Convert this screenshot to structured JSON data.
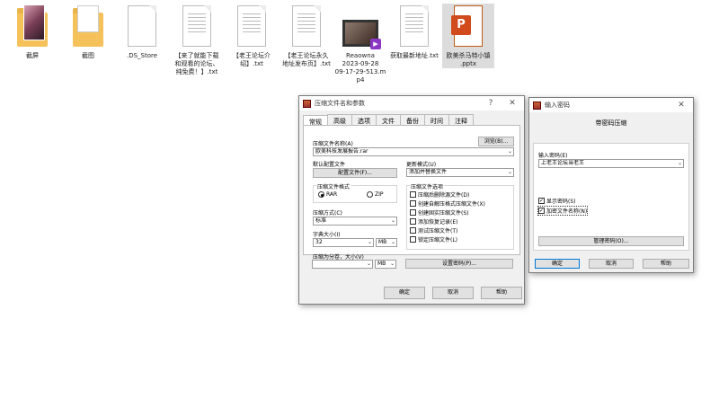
{
  "desktop": {
    "files": [
      {
        "label": "截屏",
        "type": "folder-photo"
      },
      {
        "label": "截图",
        "type": "folder-doc"
      },
      {
        "label": ".DS_Store",
        "type": "doc"
      },
      {
        "label": "【来了就能下载\n和观看的论坛、\n纯免费！】.txt",
        "type": "doc"
      },
      {
        "label": "【老王论坛介\n绍】.txt",
        "type": "doc"
      },
      {
        "label": "【老王论坛永久\n地址发布页】.txt",
        "type": "doc"
      },
      {
        "label": "Reaowna\n2023-09-28\n09-17-29-513.m\np4",
        "type": "video"
      },
      {
        "label": "获取最新地址.txt",
        "type": "doc"
      },
      {
        "label": "欧美杀马特小镇\n.pptx",
        "type": "pptx"
      }
    ]
  },
  "archive_dialog": {
    "title": "压缩文件名和参数",
    "help": "?",
    "close": "✕",
    "tabs": [
      "常规",
      "高级",
      "选项",
      "文件",
      "备份",
      "时间",
      "注释"
    ],
    "archive_name_label": "压缩文件名称(A)",
    "browse_button": "浏览(B)...",
    "archive_name_value": "欧美科技发展报告.rar",
    "default_profile_label": "默认配置文件",
    "profiles_button": "配置文件(F)...",
    "update_mode_label": "更新模式(U)",
    "update_mode_value": "添加并替换文件",
    "format_group": "压缩文件格式",
    "format_rar": "RAR",
    "format_zip": "ZIP",
    "method_label": "压缩方式(C)",
    "method_value": "标准",
    "dict_label": "字典大小(I)",
    "dict_value": "32",
    "dict_unit": "MB",
    "split_label": "压缩为分卷，大小(V)",
    "split_value": "",
    "split_unit": "MB",
    "options_group": "压缩文件选项",
    "options": [
      "压缩后删除源文件(D)",
      "创建自解压格式压缩文件(X)",
      "创建固实压缩文件(S)",
      "添加恢复记录(E)",
      "测试压缩文件(T)",
      "锁定压缩文件(L)"
    ],
    "set_password_button": "设置密码(P)...",
    "ok_button": "确定",
    "cancel_button": "取消",
    "help_button": "帮助"
  },
  "password_dialog": {
    "title": "输入密码",
    "close": "✕",
    "subtitle": "带密码压缩",
    "enter_label": "输入密码(E)",
    "password_value": "上老王论坛当老王",
    "show_password": "显示密码(S)",
    "encrypt_names": "加密文件名称(N)",
    "manage_button": "管理密码(O)...",
    "ok_button": "确定",
    "cancel_button": "取消",
    "help_button": "帮助"
  }
}
